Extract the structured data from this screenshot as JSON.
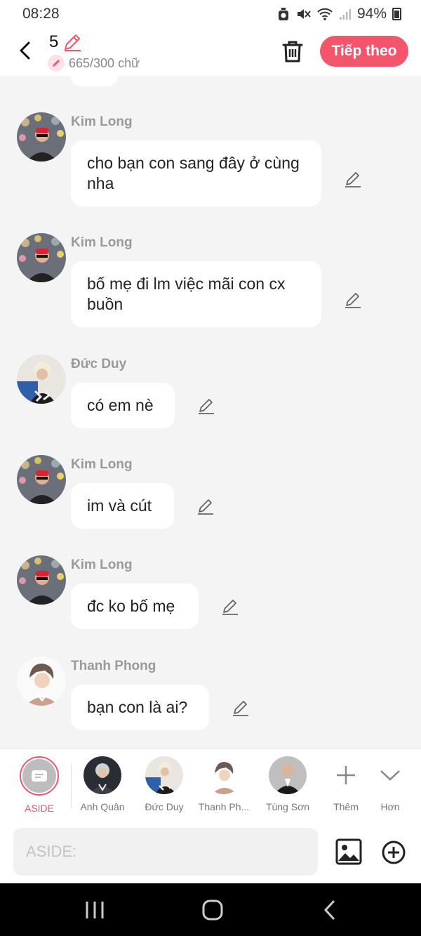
{
  "status": {
    "time": "08:28",
    "battery": "94%"
  },
  "header": {
    "count": "5",
    "word_count": "665/300 chữ",
    "next_label": "Tiếp theo"
  },
  "messages": [
    {
      "sender": "Kim Long",
      "text": "cho bạn con sang đây ở cùng nha"
    },
    {
      "sender": "Kim Long",
      "text": "bố mẹ đi lm việc mãi con cx buồn"
    },
    {
      "sender": "Đức Duy",
      "text": "có em nè"
    },
    {
      "sender": "Kim Long",
      "text": "im và cút"
    },
    {
      "sender": "Kim Long",
      "text": "đc ko bố mẹ"
    },
    {
      "sender": "Thanh Phong",
      "text": "bạn con là ai?"
    }
  ],
  "characters": [
    {
      "label": "ASIDE"
    },
    {
      "label": "Anh Quân"
    },
    {
      "label": "Đức Duy"
    },
    {
      "label": "Thanh Ph..."
    },
    {
      "label": "Tùng Sơn"
    },
    {
      "label": "Thêm"
    },
    {
      "label": "Hơn"
    }
  ],
  "input": {
    "placeholder": "ASIDE:"
  },
  "colors": {
    "accent": "#f5546d",
    "background": "#f4f4f4",
    "bubble": "#ffffff"
  }
}
